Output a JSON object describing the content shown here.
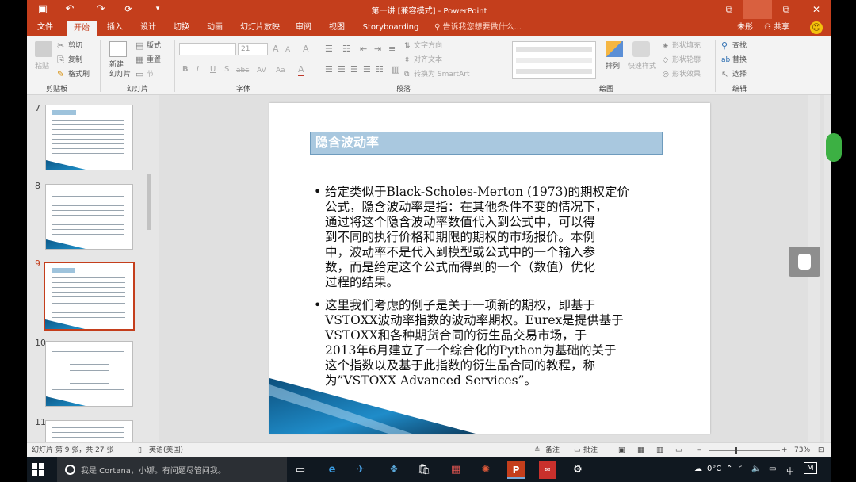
{
  "app": {
    "title": "第一讲 [兼容模式] - PowerPoint",
    "accent": "#c43e1c"
  },
  "window_controls": {
    "restore_ribbon": "⧉",
    "minimize": "–",
    "maximize": "⧉",
    "close": "✕"
  },
  "quick_access": {
    "save": "💾",
    "undo": "↶",
    "redo": "↷",
    "more": "▾"
  },
  "tabs": [
    "文件",
    "开始",
    "插入",
    "设计",
    "切换",
    "动画",
    "幻灯片放映",
    "审阅",
    "视图",
    "Storyboarding"
  ],
  "active_tab": "开始",
  "tell_me": "告诉我您想要做什么...",
  "user": "朱彤",
  "share": "共享",
  "ribbon": {
    "clipboard": {
      "label": "剪贴板",
      "paste": "粘贴",
      "cut": "剪切",
      "copy": "复制",
      "format_painter": "格式刷"
    },
    "slides": {
      "label": "幻灯片",
      "new_slide": "新建\n幻灯片",
      "layout": "版式",
      "reset": "重置",
      "section": "节"
    },
    "font": {
      "label": "字体",
      "font_name": "",
      "font_size": "21",
      "bold": "B",
      "italic": "I",
      "underline": "U",
      "strike": "S",
      "shadow": "abc",
      "spacing": "AV",
      "case": "Aa",
      "color": "A",
      "grow": "A",
      "shrink": "A",
      "clear": "A"
    },
    "paragraph": {
      "label": "段落",
      "text_direction": "文字方向",
      "align_text": "对齐文本",
      "smartart": "转换为 SmartArt"
    },
    "drawing": {
      "label": "绘图",
      "arrange": "排列",
      "quick_styles": "快速样式",
      "shape_fill": "形状填充",
      "shape_outline": "形状轮廓",
      "shape_effects": "形状效果"
    },
    "editing": {
      "label": "编辑",
      "find": "查找",
      "replace": "替换",
      "select": "选择"
    }
  },
  "thumbnails": [
    {
      "number": "7",
      "selected": false
    },
    {
      "number": "8",
      "selected": false
    },
    {
      "number": "9",
      "selected": true
    },
    {
      "number": "10",
      "selected": false
    },
    {
      "number": "11",
      "selected": false
    }
  ],
  "slide": {
    "title": "隐含波动率",
    "bullets": [
      {
        "lines": [
          "给定类似于Black-Scholes-Merton (1973)的期权定价",
          "公式，隐含波动率是指：在其他条件不变的情况下，",
          "通过将这个隐含波动率数值代入到公式中，可以得",
          "到不同的执行价格和期限的期权的市场报价。本例",
          "中，波动率不是代入到模型或公式中的一个输入参",
          "数，而是给定这个公式而得到的一个（数值）优化",
          "过程的结果。"
        ]
      },
      {
        "lines": [
          "这里我们考虑的例子是关于一项新的期权，即基于",
          "VSTOXX波动率指数的波动率期权。Eurex是提供基于",
          "VSTOXX和各种期货合同的衍生品交易市场，于",
          "2013年6月建立了一个综合化的Python为基础的关于",
          "这个指数以及基于此指数的衍生品合同的教程，称",
          "为”VSTOXX Advanced Services”。"
        ]
      }
    ]
  },
  "status": {
    "slide_info": "幻灯片 第 9 张，共 27 张",
    "language": "英语(美国)",
    "notes": "备注",
    "comments": "批注",
    "zoom": "73%",
    "zoom_minus": "–",
    "zoom_plus": "+"
  },
  "taskbar": {
    "cortana": "我是 Cortana，小娜。有问题尽管问我。",
    "temperature": "0°C",
    "ime": "中",
    "ime2": "M"
  }
}
